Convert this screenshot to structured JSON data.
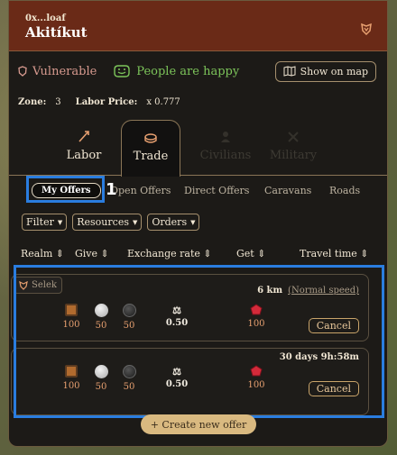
{
  "header": {
    "owner": "0x...loaf",
    "title": "Akitíkut"
  },
  "status": {
    "vulnerable": "Vulnerable",
    "happiness": "People are happy",
    "show_map": "Show on map"
  },
  "zone": {
    "zone_label": "Zone:",
    "zone_value": "3",
    "labor_price_label": "Labor Price:",
    "labor_price_value": "x 0.777"
  },
  "main_tabs": [
    {
      "label": "Labor",
      "active": false
    },
    {
      "label": "Trade",
      "active": true
    },
    {
      "label": "Civilians",
      "active": false
    },
    {
      "label": "Military",
      "active": false
    }
  ],
  "sub_tabs": [
    "My Offers",
    "Open Offers",
    "Direct Offers",
    "Caravans",
    "Roads"
  ],
  "highlight": {
    "number": "1"
  },
  "filters": [
    "Filter",
    "Resources",
    "Orders"
  ],
  "columns": [
    "Realm",
    "Give",
    "Exchange rate",
    "Get",
    "Travel time"
  ],
  "offers": [
    {
      "realm": "Selek",
      "give": [
        "100",
        "50",
        "50"
      ],
      "rate": "0.50",
      "get": "100",
      "travel": "6 km",
      "travel_note": "(Normal speed)",
      "cancel": "Cancel"
    },
    {
      "realm": "",
      "give": [
        "100",
        "50",
        "50"
      ],
      "rate": "0.50",
      "get": "100",
      "travel": "30 days 9h:58m",
      "travel_note": "",
      "cancel": "Cancel"
    }
  ],
  "create_offer": "+ Create new offer",
  "colors": {
    "header": "#6a2a17",
    "highlight": "#2a7ddf",
    "happy": "#7cc45a",
    "vulnerable": "#d79a8f"
  }
}
